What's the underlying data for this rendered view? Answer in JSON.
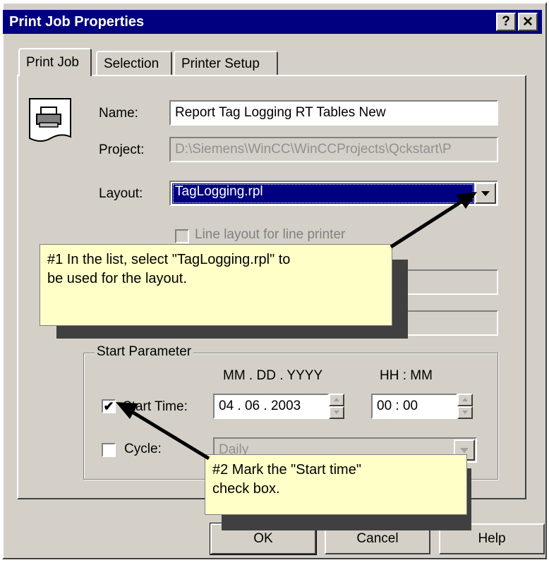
{
  "window": {
    "title": "Print Job Properties",
    "help_glyph": "?",
    "close_glyph": "✕"
  },
  "tabs": [
    {
      "label": "Print Job",
      "active": true
    },
    {
      "label": "Selection",
      "active": false
    },
    {
      "label": "Printer Setup",
      "active": false
    }
  ],
  "form": {
    "name_label": "Name:",
    "name_value": "Report Tag Logging RT Tables New",
    "project_label": "Project:",
    "project_value": "D:\\Siemens\\WinCC\\WinCCProjects\\Qckstart\\P",
    "layout_label": "Layout:",
    "layout_value": "TagLogging.rpl",
    "line_layout_label": "Line layout for line printer",
    "line_layout_checked": false
  },
  "start_parameter": {
    "group_title": "Start Parameter",
    "date_format": "MM . DD . YYYY",
    "time_format": "HH : MM",
    "start_time_label": "Start Time:",
    "start_time_checked": true,
    "date_value": "04  . 06  . 2003",
    "time_value": "00   : 00",
    "cycle_label": "Cycle:",
    "cycle_checked": false,
    "cycle_value": "Daily"
  },
  "buttons": {
    "ok": "OK",
    "cancel": "Cancel",
    "help": "Help"
  },
  "callouts": [
    {
      "text": "#1 In the list, select \"TagLogging.rpl\" to\nbe used for the layout."
    },
    {
      "text": "#2 Mark the \"Start time\"\ncheck box."
    }
  ],
  "colors": {
    "title_bar": "#000080",
    "dialog_face": "#d4d0c8",
    "selection": "#000080",
    "callout_bg": "#ffffc8"
  }
}
